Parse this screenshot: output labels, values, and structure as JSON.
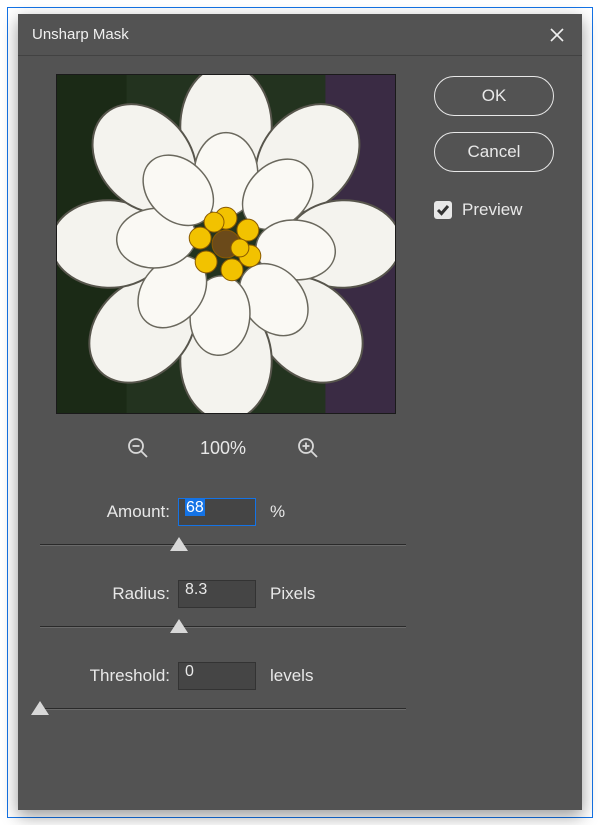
{
  "dialog": {
    "title": "Unsharp Mask"
  },
  "buttons": {
    "ok": "OK",
    "cancel": "Cancel"
  },
  "preview": {
    "label": "Preview",
    "checked": true
  },
  "zoom": {
    "level": "100%"
  },
  "params": {
    "amount": {
      "label": "Amount:",
      "value": "68",
      "unit": "%",
      "slider_pct": 38,
      "focused": true
    },
    "radius": {
      "label": "Radius:",
      "value": "8.3",
      "unit": "Pixels",
      "slider_pct": 38
    },
    "threshold": {
      "label": "Threshold:",
      "value": "0",
      "unit": "levels",
      "slider_pct": 0
    }
  }
}
